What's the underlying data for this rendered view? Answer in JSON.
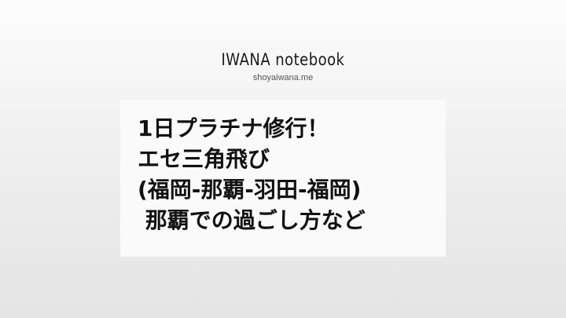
{
  "brand": {
    "title": "IWANA notebook",
    "site": "shoyaiwana.me"
  },
  "headline": {
    "lines": [
      "1日プラチナ修行！",
      "エセ三角飛び",
      "(福岡-那覇-羽田-福岡)",
      " 那覇での過ごし方など"
    ]
  }
}
